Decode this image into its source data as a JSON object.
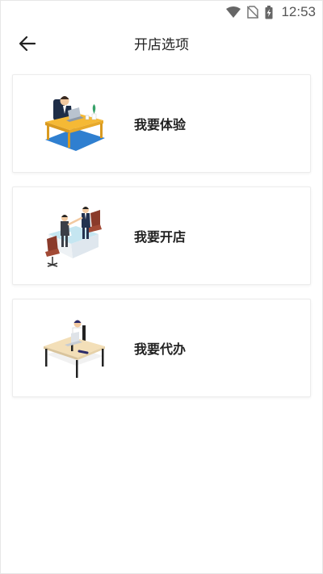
{
  "status_bar": {
    "time": "12:53",
    "icons": [
      "wifi-icon",
      "no-sim-icon",
      "battery-charging-icon"
    ]
  },
  "header": {
    "title": "开店选项",
    "back_icon": "arrow-left-icon"
  },
  "options": [
    {
      "label": "我要体验",
      "illustration": "person-at-desk-illustration"
    },
    {
      "label": "我要开店",
      "illustration": "business-meeting-illustration"
    },
    {
      "label": "我要代办",
      "illustration": "person-at-laptop-illustration"
    }
  ],
  "colors": {
    "background": "#ffffff",
    "text": "#222222",
    "card_border": "#ececec",
    "desk_yellow": "#f5b935",
    "floor_blue": "#2f7fd0"
  }
}
